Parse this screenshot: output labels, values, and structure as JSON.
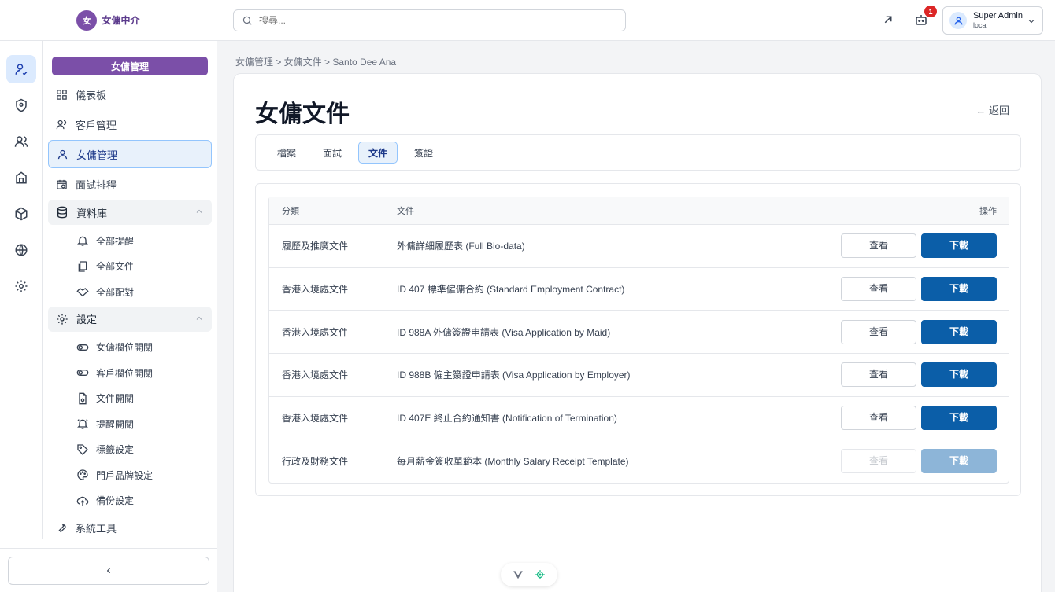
{
  "brand": {
    "logo_text": "女傭中介",
    "logo_mark": "女"
  },
  "sidebar": {
    "section_header": "女傭管理",
    "items": [
      {
        "label": "儀表板"
      },
      {
        "label": "客戶管理"
      },
      {
        "label": "女傭管理"
      },
      {
        "label": "面試排程"
      }
    ],
    "database": {
      "label": "資料庫",
      "children": [
        {
          "label": "全部提醒"
        },
        {
          "label": "全部文件"
        },
        {
          "label": "全部配對"
        }
      ]
    },
    "settings": {
      "label": "設定",
      "children": [
        {
          "label": "女傭欄位開關"
        },
        {
          "label": "客戶欄位開關"
        },
        {
          "label": "文件開關"
        },
        {
          "label": "提醒開關"
        },
        {
          "label": "標籤設定"
        },
        {
          "label": "門戶品牌設定"
        },
        {
          "label": "備份設定"
        }
      ]
    },
    "tools": {
      "label": "系統工具"
    },
    "collapse_glyph": "‹"
  },
  "topbar": {
    "search_placeholder": "搜尋...",
    "notification_count": "1",
    "user_name": "Super Admin",
    "user_role": "local"
  },
  "breadcrumb": "女傭管理 > 女傭文件 > Santo Dee Ana",
  "page": {
    "title": "女傭文件",
    "back_label": "← 返回",
    "tabs": [
      {
        "label": "檔案"
      },
      {
        "label": "面試"
      },
      {
        "label": "文件"
      },
      {
        "label": "簽證"
      }
    ]
  },
  "table": {
    "headers": {
      "category": "分類",
      "document": "文件",
      "actions": "操作"
    },
    "view_label": "查看",
    "download_label": "下載",
    "rows": [
      {
        "category": "履歷及推廣文件",
        "document": "外傭詳細履歷表 (Full Bio-data)"
      },
      {
        "category": "香港入境處文件",
        "document": "ID 407 標準僱傭合約 (Standard Employment Contract)"
      },
      {
        "category": "香港入境處文件",
        "document": "ID 988A 外傭簽證申請表 (Visa Application by Maid)"
      },
      {
        "category": "香港入境處文件",
        "document": "ID 988B 僱主簽證申請表 (Visa Application by Employer)"
      },
      {
        "category": "香港入境處文件",
        "document": "ID 407E 終止合約通知書 (Notification of Termination)"
      },
      {
        "category": "行政及財務文件",
        "document": "每月薪金簽收單範本 (Monthly Salary Receipt Template)"
      }
    ]
  },
  "colors": {
    "accent_purple": "#7b4fa8",
    "primary_blue": "#0b5ea8",
    "disabled_blue": "#8db5d8"
  }
}
